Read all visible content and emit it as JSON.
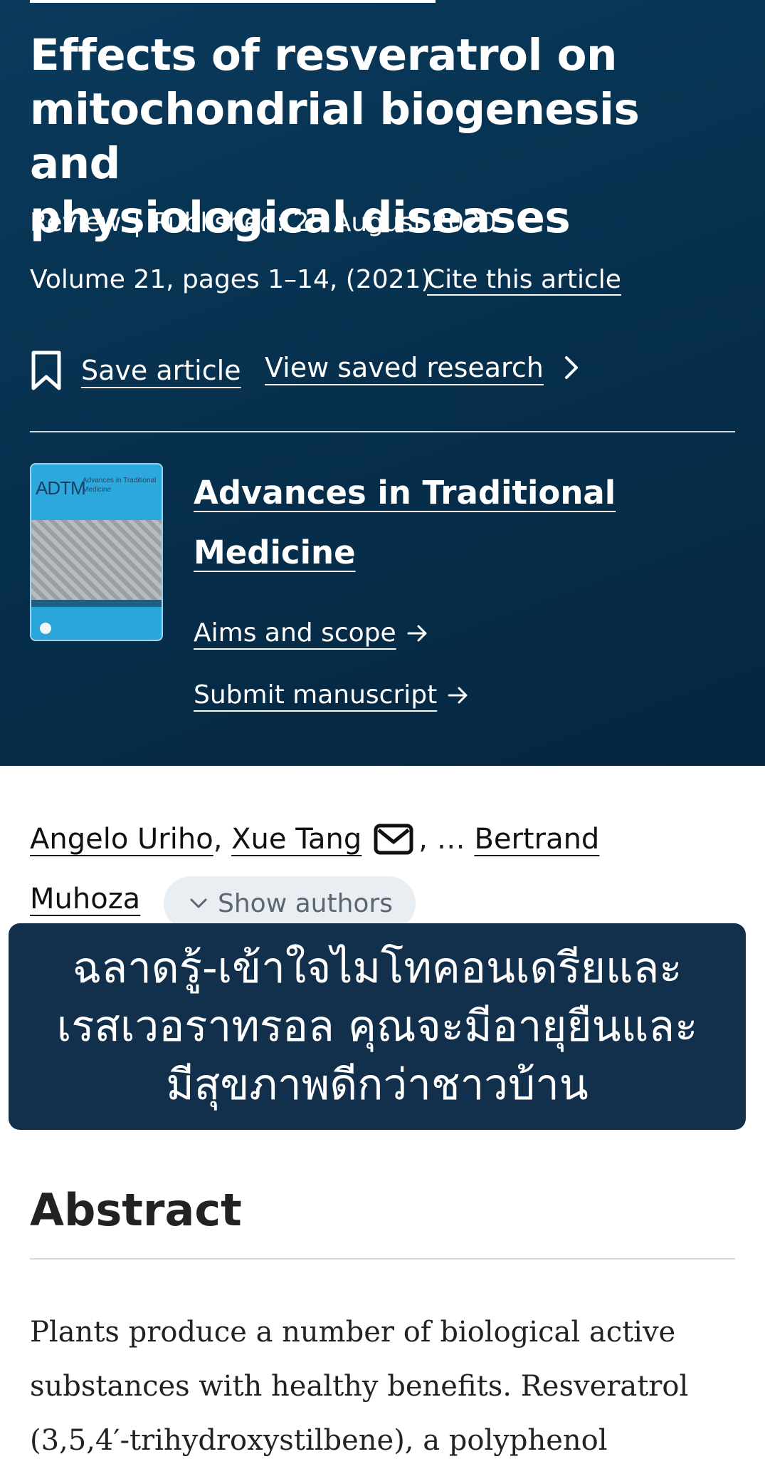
{
  "article": {
    "title_lines": [
      "Effects of resveratrol on",
      "mitochondrial biogenesis and",
      "physiological diseases"
    ],
    "type": "Review",
    "published": "Published: 25 August 2020",
    "volume_info": "Volume 21, pages 1–14, (2021)",
    "cite_label": "Cite this article",
    "save_label": "Save article",
    "view_saved_label": "View saved research"
  },
  "journal": {
    "name_lines": [
      "Advances in Traditional",
      "Medicine"
    ],
    "cover_brand": "ADTM",
    "cover_subtitle": "Advances in Traditional Medicine",
    "aims_label": "Aims and scope",
    "submit_label": "Submit manuscript"
  },
  "authors": {
    "author_1": "Angelo Uriho",
    "author_2": "Xue Tang",
    "ellipsis": ", …",
    "author_last_first": "Bertrand",
    "author_last_second": "Muhoza",
    "show_authors_label": "Show authors"
  },
  "overlay": {
    "lines": [
      "ฉลาดรู้-เข้าใจไมโทคอนเดรียและ",
      "เรสเวอราทรอล คุณจะมีอายุยืนและ",
      "มีสุขภาพดีกว่าชาวบ้าน"
    ]
  },
  "abstract": {
    "heading": "Abstract",
    "lines": [
      "Plants produce a number of biological active",
      "substances with healthy benefits. Resveratrol",
      "(3,5,4′-trihydroxystilbene), a polyphenol"
    ]
  },
  "icons": {
    "bookmark": "bookmark-icon",
    "chevron": "chevron-right-icon",
    "arrow": "arrow-right-icon",
    "mail": "mail-icon",
    "chevron_down": "chevron-down-icon"
  },
  "colors": {
    "hero_bg": "#07314f",
    "overlay_bg": "#122f4b",
    "pill_bg": "#e9eef3"
  }
}
